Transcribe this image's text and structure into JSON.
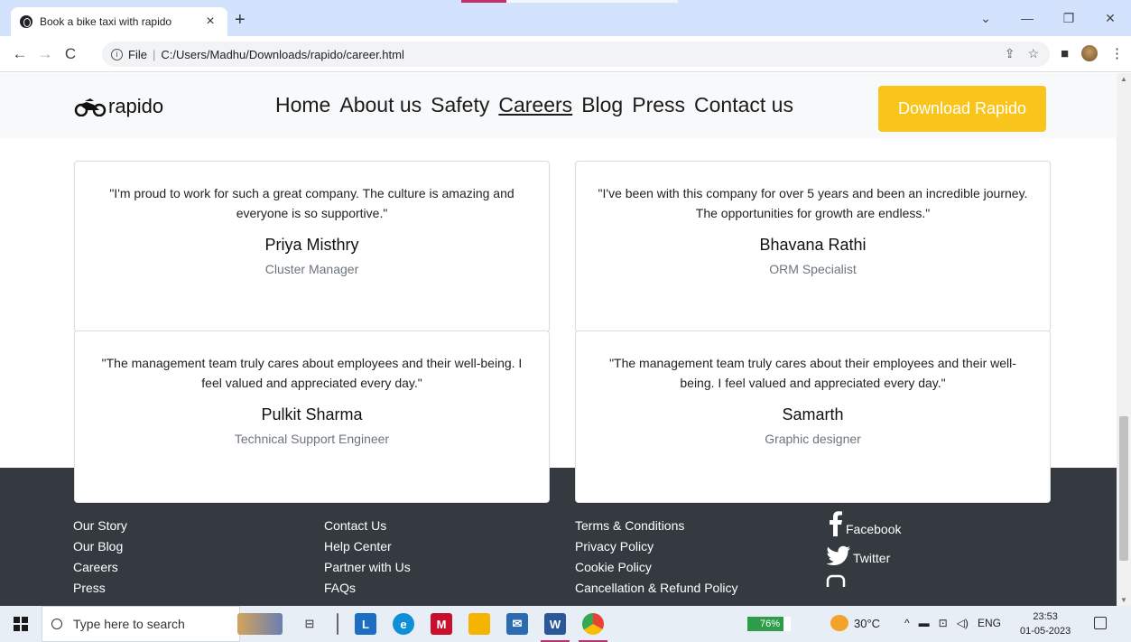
{
  "browser": {
    "tab_title": "Book a bike taxi with rapido",
    "tab_close": "×",
    "new_tab": "+",
    "address_prefix": "File",
    "address_path": "C:/Users/Madhu/Downloads/rapido/career.html"
  },
  "header": {
    "logo_text": "rapido",
    "nav": [
      "Home",
      "About us",
      "Safety",
      "Careers",
      "Blog",
      "Press",
      "Contact us"
    ],
    "active_nav": "Careers",
    "download_button": "Download Rapido",
    "accent_color": "#f9c41b"
  },
  "testimonials": [
    {
      "quote": "\"I'm proud to work for such a great company. The culture is amazing and everyone is so supportive.\"",
      "name": "Priya Misthry",
      "role": "Cluster Manager"
    },
    {
      "quote": "\"I've been with this company for over 5 years and been an incredible journey. The opportunities for growth are endless.\"",
      "name": "Bhavana Rathi",
      "role": "ORM Specialist"
    },
    {
      "quote": "\"The management team truly cares about employees and their well-being. I feel valued and appreciated every day.\"",
      "name": "Pulkit Sharma",
      "role": "Technical Support Engineer"
    },
    {
      "quote": "\"The management team truly cares about their employees and their well-being. I feel valued and appreciated every day.\"",
      "name": "Samarth",
      "role": "Graphic designer"
    }
  ],
  "footer": {
    "col1": [
      "Our Story",
      "Our Blog",
      "Careers",
      "Press"
    ],
    "col2": [
      "Contact Us",
      "Help Center",
      "Partner with Us",
      "FAQs"
    ],
    "col3": [
      "Terms & Conditions",
      "Privacy Policy",
      "Cookie Policy",
      "Cancellation & Refund Policy"
    ],
    "social": [
      "Facebook",
      "Twitter"
    ]
  },
  "taskbar": {
    "search_placeholder": "Type here to search",
    "battery": "76%",
    "temperature": "30°C",
    "language": "ENG",
    "time": "23:53",
    "date": "01-05-2023"
  }
}
